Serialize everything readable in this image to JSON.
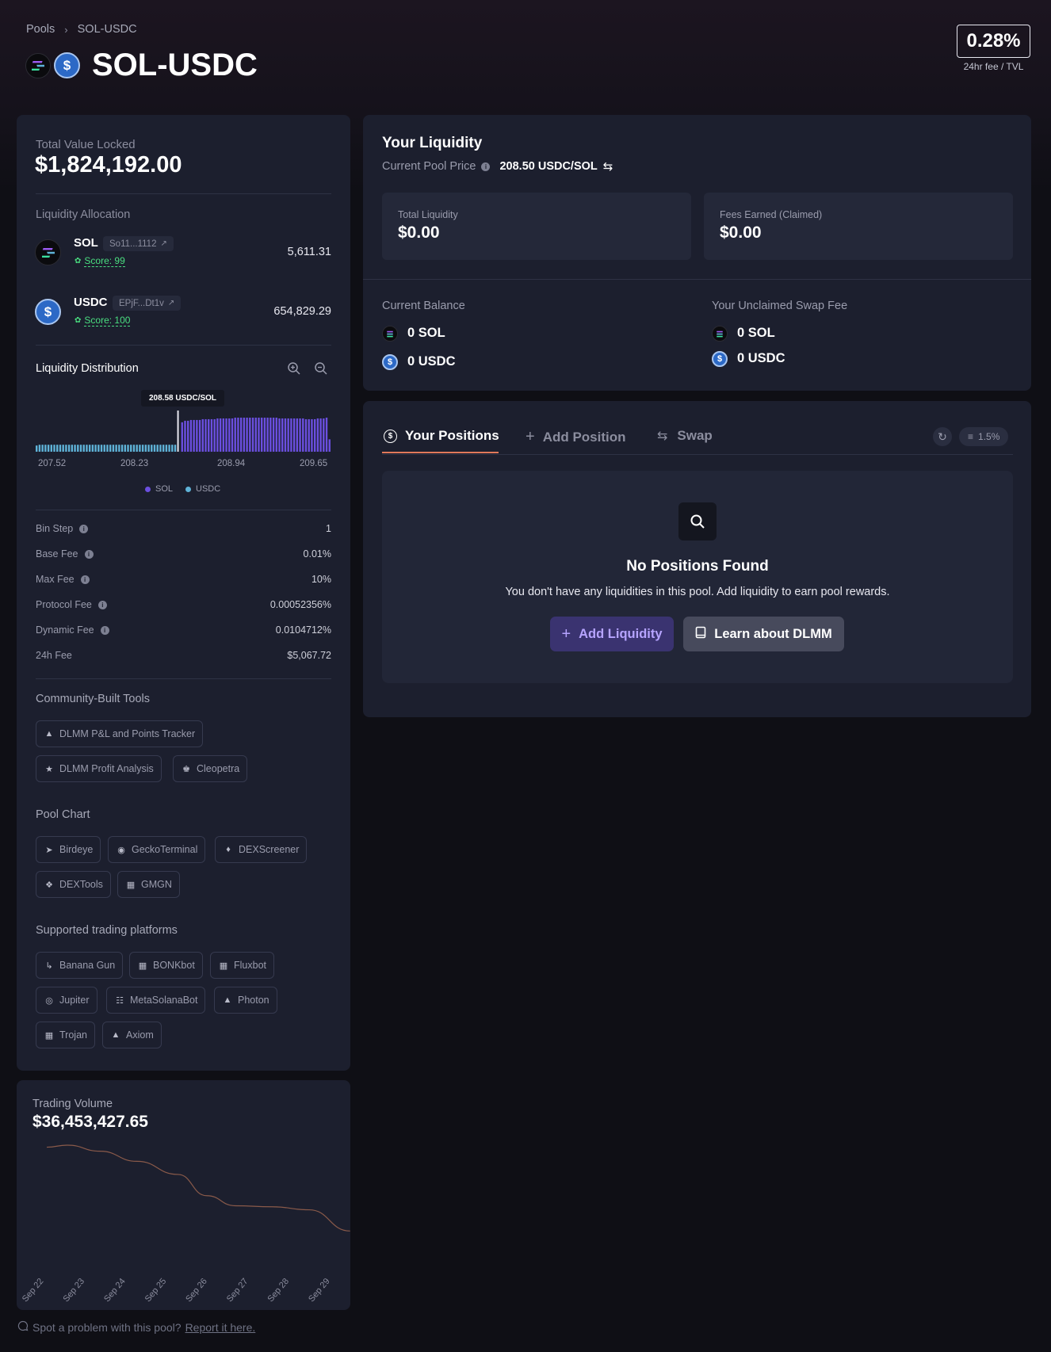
{
  "breadcrumb": {
    "root": "Pools",
    "current": "SOL-USDC"
  },
  "pool": {
    "title": "SOL-USDC",
    "fee_tvl": "0.28%",
    "fee_tvl_label": "24hr fee / TVL"
  },
  "tvl": {
    "label": "Total Value Locked",
    "value": "$1,824,192.00"
  },
  "allocation": {
    "label": "Liquidity Allocation",
    "tokens": [
      {
        "symbol": "SOL",
        "address": "So11...1112",
        "score": "Score: 99",
        "amount": "5,611.31"
      },
      {
        "symbol": "USDC",
        "address": "EPjF...Dt1v",
        "score": "Score: 100",
        "amount": "654,829.29"
      }
    ]
  },
  "distribution": {
    "label": "Liquidity Distribution",
    "current_price_label": "208.58 USDC/SOL",
    "ticks": [
      "207.52",
      "208.23",
      "208.94",
      "209.65"
    ],
    "legend": [
      "SOL",
      "USDC"
    ]
  },
  "chart_data": [
    {
      "type": "bar",
      "title": "Liquidity Distribution",
      "x_range": [
        207.52,
        209.65
      ],
      "current_price": 208.58,
      "series": [
        {
          "name": "USDC",
          "color": "#5fb3d8",
          "values": [
            8,
            9,
            9,
            9,
            9,
            9,
            9,
            9,
            9,
            9,
            9,
            9,
            9,
            9,
            9,
            9,
            9,
            9,
            9,
            9,
            9,
            9,
            9,
            9,
            9,
            9,
            9,
            9,
            9,
            9,
            9,
            9,
            9,
            9,
            9,
            9,
            9,
            9,
            9,
            9,
            9,
            9,
            9,
            9,
            9,
            9,
            9,
            9
          ]
        },
        {
          "name": "SOL",
          "color": "#6b4fe0",
          "values": [
            38,
            40,
            40,
            41,
            41,
            41,
            41,
            42,
            42,
            42,
            42,
            42,
            43,
            43,
            43,
            43,
            43,
            43,
            44,
            44,
            44,
            44,
            44,
            44,
            44,
            44,
            44,
            44,
            44,
            44,
            44,
            44,
            44,
            43,
            43,
            43,
            43,
            43,
            43,
            43,
            43,
            43,
            42,
            42,
            42,
            42,
            43,
            43,
            43,
            44,
            16,
            16
          ]
        }
      ]
    },
    {
      "type": "line",
      "title": "Trading Volume",
      "categories": [
        "Sep 22",
        "Sep 23",
        "Sep 24",
        "Sep 25",
        "Sep 26",
        "Sep 27",
        "Sep 28",
        "Sep 29"
      ],
      "values": [
        100,
        102,
        96,
        86,
        73,
        52,
        42,
        41,
        38,
        17
      ],
      "x_points": [
        0,
        0.5,
        1.3,
        2.2,
        3.2,
        3.9,
        4.6,
        5.5,
        6.4,
        7.4
      ],
      "color": "#8a5a4a"
    }
  ],
  "fees": {
    "rows": [
      {
        "label": "Bin Step",
        "value": "1",
        "info": true
      },
      {
        "label": "Base Fee",
        "value": "0.01%",
        "info": true
      },
      {
        "label": "Max Fee",
        "value": "10%",
        "info": true
      },
      {
        "label": "Protocol Fee",
        "value": "0.00052356%",
        "info": true
      },
      {
        "label": "Dynamic Fee",
        "value": "0.0104712%",
        "info": true
      },
      {
        "label": "24h Fee",
        "value": "$5,067.72",
        "info": false
      }
    ]
  },
  "community_tools": {
    "label": "Community-Built Tools",
    "items": [
      "DLMM P&L and Points Tracker",
      "DLMM Profit Analysis",
      "Cleopetra"
    ]
  },
  "pool_chart": {
    "label": "Pool Chart",
    "items": [
      "Birdeye",
      "GeckoTerminal",
      "DEXScreener",
      "DEXTools",
      "GMGN"
    ]
  },
  "platforms": {
    "label": "Supported trading platforms",
    "items": [
      "Banana Gun",
      "BONKbot",
      "Fluxbot",
      "Jupiter",
      "MetaSolanaBot",
      "Photon",
      "Trojan",
      "Axiom"
    ]
  },
  "volume": {
    "label": "Trading Volume",
    "value": "$36,453,427.65"
  },
  "liquidity": {
    "title": "Your Liquidity",
    "price_label": "Current Pool Price",
    "price_value": "208.50 USDC/SOL",
    "total_label": "Total Liquidity",
    "total_value": "$0.00",
    "fees_label": "Fees Earned (Claimed)",
    "fees_value": "$0.00",
    "balance_label": "Current Balance",
    "balance": [
      "0 SOL",
      "0 USDC"
    ],
    "unclaimed_label": "Your Unclaimed Swap Fee",
    "unclaimed": [
      "0 SOL",
      "0 USDC"
    ]
  },
  "positions": {
    "tabs": [
      "Your Positions",
      "Add Position",
      "Swap"
    ],
    "slippage": "1.5%",
    "empty_title": "No Positions Found",
    "empty_text": "You don't have any liquidities in this pool. Add liquidity to earn pool rewards.",
    "add_button": "Add Liquidity",
    "learn_button": "Learn about DLMM"
  },
  "footer": {
    "text": "Spot a problem with this pool?",
    "link": "Report it here."
  },
  "colors": {
    "accent": "#6b4fe0",
    "usdc": "#5fb3d8",
    "score": "#4ade80",
    "tab_underline": "#e0785a"
  }
}
